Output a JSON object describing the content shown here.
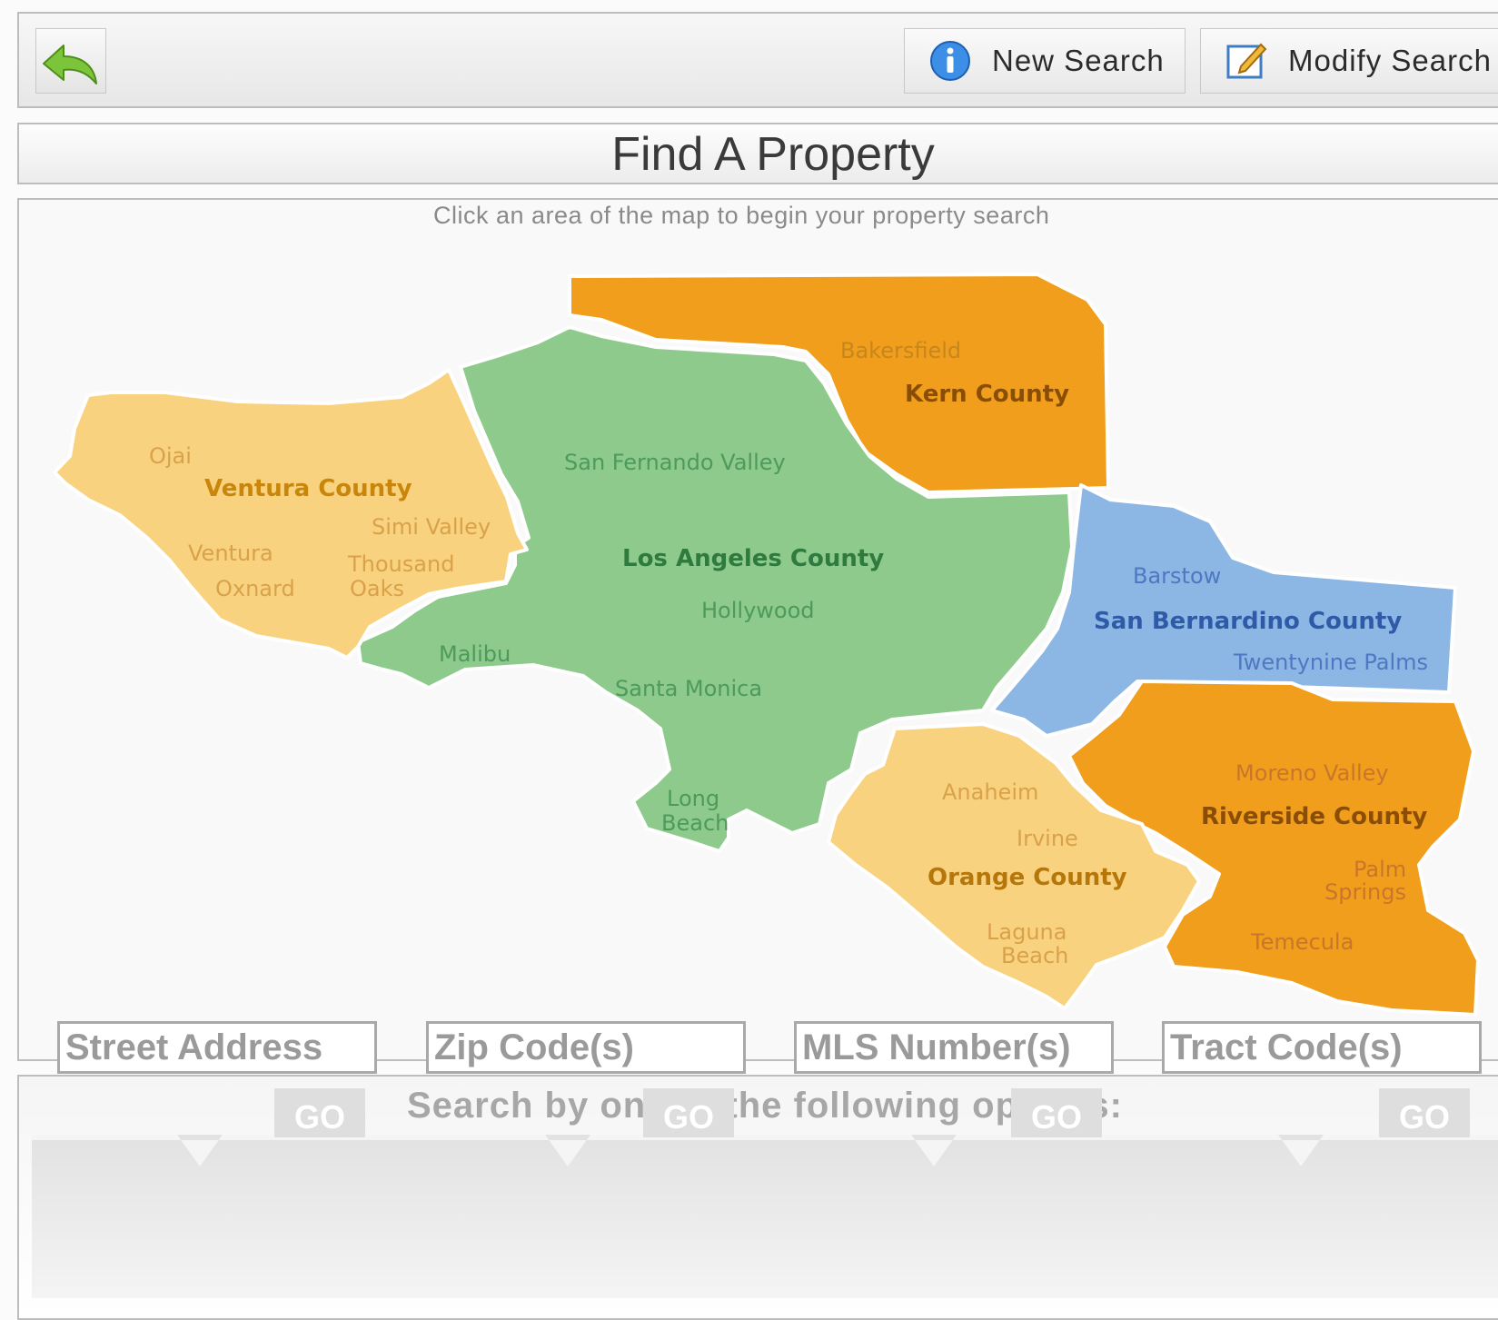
{
  "toolbar": {
    "new_search_label": "New Search",
    "modify_search_label": "Modify Search",
    "back_icon": "back-arrow-icon",
    "new_search_icon": "info-icon",
    "modify_search_icon": "edit-icon"
  },
  "page_title": "Find A Property",
  "map": {
    "instruction": "Click an area of the map to begin your property search",
    "regions": {
      "ventura": {
        "name": "Ventura County",
        "color": "#f9d27f",
        "label_color": "#c8860a",
        "cities": [
          "Ojai",
          "Simi Valley",
          "Ventura",
          "Thousand",
          "Oaks",
          "Oxnard"
        ]
      },
      "la": {
        "name": "Los Angeles County",
        "color": "#8dca8b",
        "label_color": "#2f7a3e",
        "cities": [
          "San Fernando Valley",
          "Hollywood",
          "Malibu",
          "Santa Monica",
          "Long",
          "Beach"
        ]
      },
      "kern": {
        "name": "Kern County",
        "color": "#f09e1b",
        "label_color": "#8a4d06",
        "cities": [
          "Bakersfield"
        ]
      },
      "sb": {
        "name": "San Bernardino County",
        "color": "#8cb6e3",
        "label_color": "#2f5aa8",
        "cities": [
          "Barstow",
          "Twentynine Palms"
        ]
      },
      "orange": {
        "name": "Orange County",
        "color": "#f9d27f",
        "label_color": "#b5760a",
        "cities": [
          "Anaheim",
          "Irvine",
          "Laguna",
          "Beach"
        ]
      },
      "riverside": {
        "name": "Riverside County",
        "color": "#f09e1b",
        "label_color": "#8a4d06",
        "cities": [
          "Moreno Valley",
          "Palm",
          "Springs",
          "Temecula"
        ]
      }
    }
  },
  "search": {
    "heading": "Search by one of the following options:",
    "fields": [
      {
        "placeholder": "Street Address",
        "go": "GO"
      },
      {
        "placeholder": "Zip Code(s)",
        "go": "GO"
      },
      {
        "placeholder": "MLS Number(s)",
        "go": "GO"
      },
      {
        "placeholder": "Tract Code(s)",
        "go": "GO"
      }
    ]
  }
}
